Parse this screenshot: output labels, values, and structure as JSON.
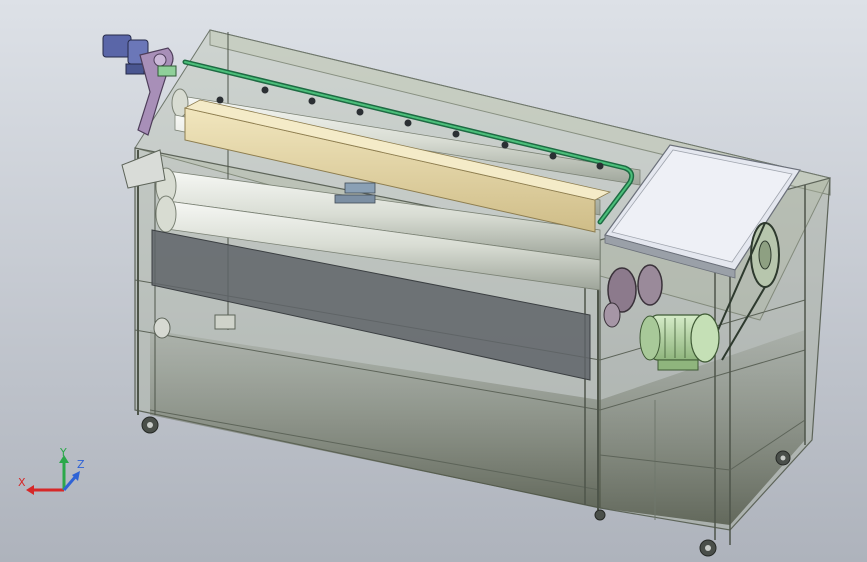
{
  "triad": {
    "x_label": "X",
    "y_label": "Y",
    "z_label": "Z",
    "x_color": "#d62828",
    "y_color": "#2ba84a",
    "z_color": "#2f63d6"
  },
  "colors": {
    "frame": "#8a9288",
    "glass": "#b9c2ad",
    "roller": "#e9ece6",
    "wood": "#e8d9a8",
    "pipe": "#1f7f4a",
    "motor": "#b6d9a8",
    "gearmotor": "#5a66a8",
    "bracket": "#a88fb8",
    "panel": "#e6e8f0"
  },
  "icons": {
    "triad": "coordinate-triad-icon"
  }
}
